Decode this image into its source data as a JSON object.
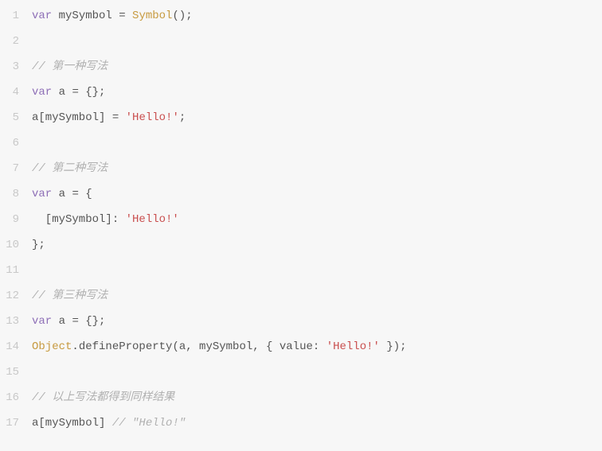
{
  "lines": [
    {
      "n": "1",
      "tokens": [
        [
          "kw",
          "var"
        ],
        [
          "ident",
          " mySymbol "
        ],
        [
          "op",
          "= "
        ],
        [
          "fn",
          "Symbol"
        ],
        [
          "ident",
          "();"
        ]
      ]
    },
    {
      "n": "2",
      "tokens": []
    },
    {
      "n": "3",
      "tokens": [
        [
          "cmt",
          "// 第一种写法"
        ]
      ]
    },
    {
      "n": "4",
      "tokens": [
        [
          "kw",
          "var"
        ],
        [
          "ident",
          " a "
        ],
        [
          "op",
          "= "
        ],
        [
          "ident",
          "{};"
        ]
      ]
    },
    {
      "n": "5",
      "tokens": [
        [
          "ident",
          "a[mySymbol] "
        ],
        [
          "op",
          "= "
        ],
        [
          "str",
          "'Hello!'"
        ],
        [
          "ident",
          ";"
        ]
      ]
    },
    {
      "n": "6",
      "tokens": []
    },
    {
      "n": "7",
      "tokens": [
        [
          "cmt",
          "// 第二种写法"
        ]
      ]
    },
    {
      "n": "8",
      "tokens": [
        [
          "kw",
          "var"
        ],
        [
          "ident",
          " a "
        ],
        [
          "op",
          "= "
        ],
        [
          "ident",
          "{"
        ]
      ]
    },
    {
      "n": "9",
      "tokens": [
        [
          "ident",
          "  [mySymbol]: "
        ],
        [
          "str",
          "'Hello!'"
        ]
      ]
    },
    {
      "n": "10",
      "tokens": [
        [
          "ident",
          "};"
        ]
      ]
    },
    {
      "n": "11",
      "tokens": []
    },
    {
      "n": "12",
      "tokens": [
        [
          "cmt",
          "// 第三种写法"
        ]
      ]
    },
    {
      "n": "13",
      "tokens": [
        [
          "kw",
          "var"
        ],
        [
          "ident",
          " a "
        ],
        [
          "op",
          "= "
        ],
        [
          "ident",
          "{};"
        ]
      ]
    },
    {
      "n": "14",
      "tokens": [
        [
          "obj",
          "Object"
        ],
        [
          "ident",
          ".defineProperty(a, mySymbol, { "
        ],
        [
          "ident",
          "value"
        ],
        [
          "ident",
          ": "
        ],
        [
          "str",
          "'Hello!'"
        ],
        [
          "ident",
          " });"
        ]
      ]
    },
    {
      "n": "15",
      "tokens": []
    },
    {
      "n": "16",
      "tokens": [
        [
          "cmt",
          "// 以上写法都得到同样结果"
        ]
      ]
    },
    {
      "n": "17",
      "tokens": [
        [
          "ident",
          "a[mySymbol] "
        ],
        [
          "cmt",
          "// \"Hello!\""
        ]
      ]
    }
  ]
}
